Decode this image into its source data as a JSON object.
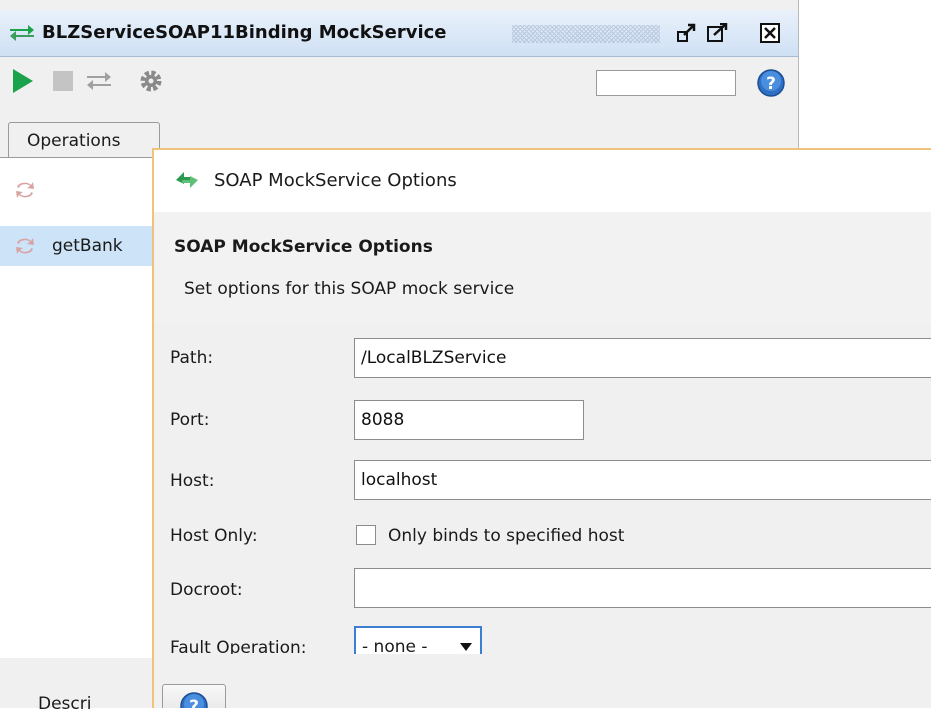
{
  "window": {
    "title": "BLZServiceSOAP11Binding MockService",
    "icons": {
      "title": "mock-service-icon",
      "dock": "dock-icon",
      "maximize": "maximize-icon",
      "close": "close-icon"
    }
  },
  "toolbar": {
    "icons": [
      "play-icon",
      "stop-icon",
      "swap-icon",
      "gear-icon",
      "help-icon"
    ],
    "search_value": ""
  },
  "operations": {
    "tab_label": "Operations",
    "items": [
      {
        "label": "",
        "icon": "operation-icon"
      },
      {
        "label": "getBank",
        "icon": "operation-icon",
        "selected": true
      }
    ]
  },
  "bottom_tab": {
    "label": "Descri"
  },
  "dialog": {
    "title": "SOAP MockService Options",
    "heading": "SOAP MockService Options",
    "subheading": "Set options for this SOAP mock service",
    "fields": {
      "path": {
        "label": "Path:",
        "value": "/LocalBLZService"
      },
      "port": {
        "label": "Port:",
        "value": "8088"
      },
      "host": {
        "label": "Host:",
        "value": "localhost"
      },
      "host_only": {
        "label": "Host Only:",
        "checkbox_label": "Only binds to specified host",
        "checked": false
      },
      "docroot": {
        "label": "Docroot:",
        "value": ""
      },
      "fault_operation": {
        "label": "Fault Operation:",
        "selected": "- none -"
      }
    }
  },
  "colors": {
    "accent": "#3c7fd1",
    "selection": "#cde3f7",
    "dialog_border": "#f0c37a",
    "play": "#1aa34a"
  }
}
